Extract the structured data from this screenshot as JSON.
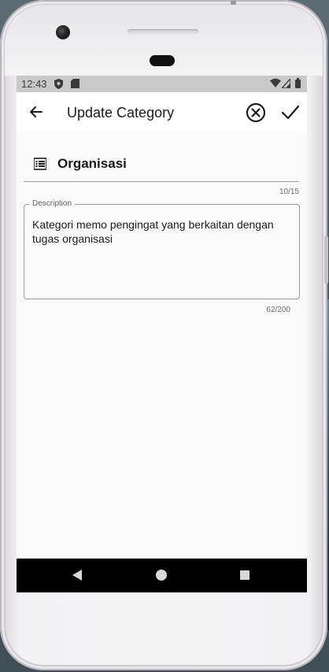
{
  "status_bar": {
    "time": "12:43",
    "icons": [
      "shield-icon",
      "sd-card-icon",
      "wifi-icon",
      "signal-icon",
      "battery-icon"
    ]
  },
  "app_bar": {
    "title": "Update Category",
    "back_icon": "arrow-back-icon",
    "cancel_icon": "cancel-circle-icon",
    "confirm_icon": "check-icon"
  },
  "form": {
    "name": {
      "icon": "list-icon",
      "value": "Organisasi",
      "counter": "10/15"
    },
    "description": {
      "label": "Description",
      "value": "Kategori memo pengingat yang berkaitan dengan tugas organisasi",
      "counter": "62/200"
    }
  },
  "nav_bar": {
    "icons": [
      "nav-back-icon",
      "nav-home-icon",
      "nav-recents-icon"
    ]
  },
  "colors": {
    "app_bar_bg": "#ffffff",
    "screen_bg": "#fafafa",
    "status_bar_bg": "#c9c9c9",
    "nav_bar_bg": "#000000"
  }
}
